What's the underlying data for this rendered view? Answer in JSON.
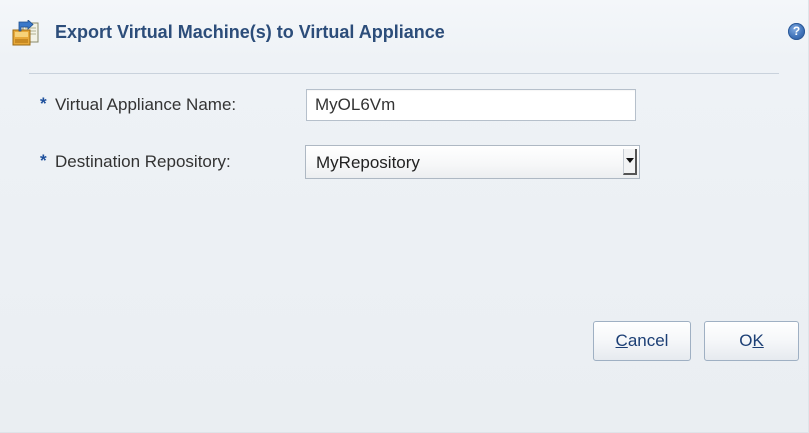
{
  "dialog": {
    "title": "Export Virtual Machine(s) to Virtual Appliance",
    "title_icon": "export-appliance-icon",
    "help_icon": "help-icon",
    "help_glyph": "?"
  },
  "form": {
    "required_marker": "*",
    "appliance_name": {
      "label": "Virtual Appliance Name:",
      "value": "MyOL6Vm"
    },
    "destination_repository": {
      "label": "Destination Repository:",
      "selected": "MyRepository"
    }
  },
  "buttons": {
    "cancel": {
      "mnemonic": "C",
      "rest": "ancel"
    },
    "ok": {
      "prefix": "O",
      "mnemonic": "K"
    }
  },
  "colors": {
    "title": "#2c4d7a",
    "required_marker": "#1d4f9c",
    "button_text": "#1c3f75"
  }
}
